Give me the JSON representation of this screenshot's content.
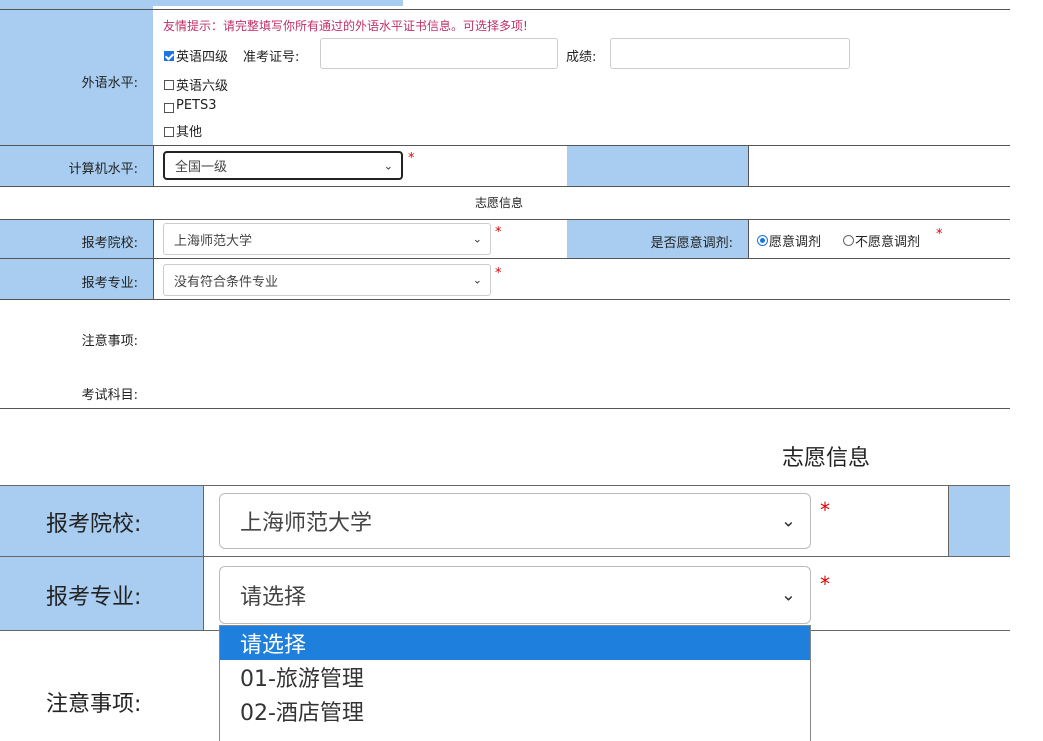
{
  "foreign_language": {
    "label": "外语水平:",
    "hint": "友情提示：请完整填写你所有通过的外语水平证书信息。可选择多项!",
    "items": [
      {
        "label": "英语四级",
        "checked": true
      },
      {
        "label": "英语六级",
        "checked": false
      },
      {
        "label": "PETS3",
        "checked": false
      },
      {
        "label": "其他",
        "checked": false
      }
    ],
    "ticket_label": "准考证号:",
    "ticket_value": "",
    "score_label": "成绩:",
    "score_value": ""
  },
  "computer": {
    "label": "计算机水平:",
    "selected": "全国一级"
  },
  "section_title_small": "志愿信息",
  "school": {
    "label": "报考院校:",
    "selected": "上海师范大学"
  },
  "adjust": {
    "label": "是否愿意调剂:",
    "options": [
      {
        "label": "愿意调剂",
        "checked": true
      },
      {
        "label": "不愿意调剂",
        "checked": false
      }
    ]
  },
  "major": {
    "label": "报考专业:",
    "selected": "没有符合条件专业"
  },
  "notes_label": "注意事项:",
  "subjects_label": "考试科目:",
  "required_mark": "*",
  "zoomed": {
    "section_title": "志愿信息",
    "school_label": "报考院校:",
    "school_selected": "上海师范大学",
    "major_label": "报考专业:",
    "major_selected": "请选择",
    "notes_label": "注意事项:",
    "dropdown_options": [
      "请选择",
      "01-旅游管理",
      "02-酒店管理"
    ],
    "dropdown_highlight_index": 0
  },
  "colors": {
    "label_bg": "#a8cdf0",
    "highlight": "#1e7fdc",
    "required": "#dd0000",
    "hint": "#c0306b"
  }
}
